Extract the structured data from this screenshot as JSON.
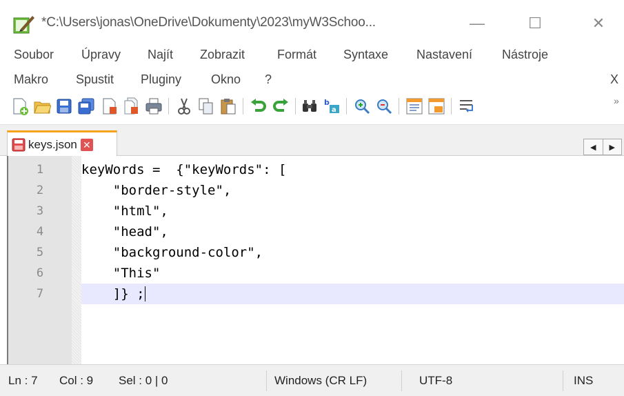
{
  "window": {
    "title": "*C:\\Users\\jonas\\OneDrive\\Dokumenty\\2023\\myW3Schoo...",
    "minimize": "—",
    "maximize": "☐",
    "close": "✕"
  },
  "menu": {
    "row1": [
      "Soubor",
      "Úpravy",
      "Najít",
      "Zobrazit",
      "Formát",
      "Syntaxe",
      "Nastavení",
      "Nástroje"
    ],
    "row2": [
      "Makro",
      "Spustit",
      "Pluginy",
      "Okno",
      "?"
    ],
    "close_doc": "X"
  },
  "toolbar": {
    "icons": [
      "new-file-icon",
      "open-folder-icon",
      "save-icon",
      "save-all-icon",
      "close-icon",
      "close-all-icon",
      "print-icon",
      "cut-icon",
      "copy-icon",
      "paste-icon",
      "undo-icon",
      "redo-icon",
      "find-icon",
      "replace-icon",
      "zoom-in-icon",
      "zoom-out-icon",
      "sync-vertical-icon",
      "sync-horizontal-icon",
      "word-wrap-icon"
    ],
    "overflow": "»"
  },
  "tabs": [
    {
      "label": "keys.json",
      "active": true,
      "modified": true,
      "close": "✕"
    }
  ],
  "tab_scroll": {
    "left": "◀",
    "right": "▶"
  },
  "editor": {
    "lines": [
      {
        "num": "1",
        "text": "keyWords =  {\"keyWords\": ["
      },
      {
        "num": "2",
        "text": "    \"border-style\","
      },
      {
        "num": "3",
        "text": "    \"html\","
      },
      {
        "num": "4",
        "text": "    \"head\","
      },
      {
        "num": "5",
        "text": "    \"background-color\","
      },
      {
        "num": "6",
        "text": "    \"This\""
      },
      {
        "num": "7",
        "text": "    ]} ;"
      }
    ],
    "current_line": 7
  },
  "status": {
    "ln": "Ln : 7",
    "col": "Col : 9",
    "sel": "Sel : 0 | 0",
    "eol": "Windows (CR LF)",
    "encoding": "UTF-8",
    "mode": "INS"
  },
  "colors": {
    "tab_accent": "#f7a21b",
    "current_line": "#e8e8ff",
    "tab_close": "#e15252"
  }
}
